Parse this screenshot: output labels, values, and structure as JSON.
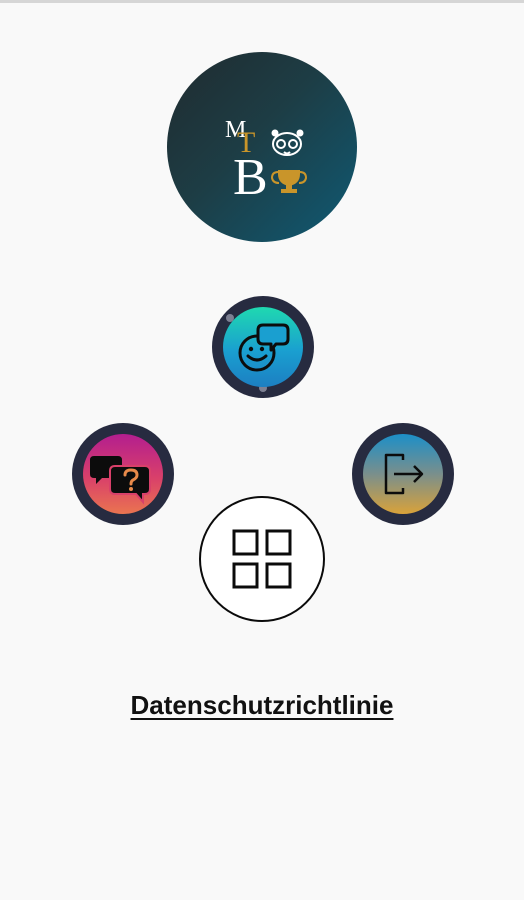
{
  "app": {
    "logo_letters": {
      "m": "M",
      "t": "T",
      "b": "B"
    }
  },
  "privacy": {
    "label": "Datenschutzrichtlinie"
  },
  "icons": {
    "logo": "mtb-logo-icon",
    "chat": "smiley-chat-icon",
    "faq": "question-chat-icon",
    "logout": "logout-icon",
    "menu": "grid-icon"
  },
  "colors": {
    "background": "#f9f9f9",
    "ring": "#272b40",
    "logo_gold": "#c9952a"
  }
}
